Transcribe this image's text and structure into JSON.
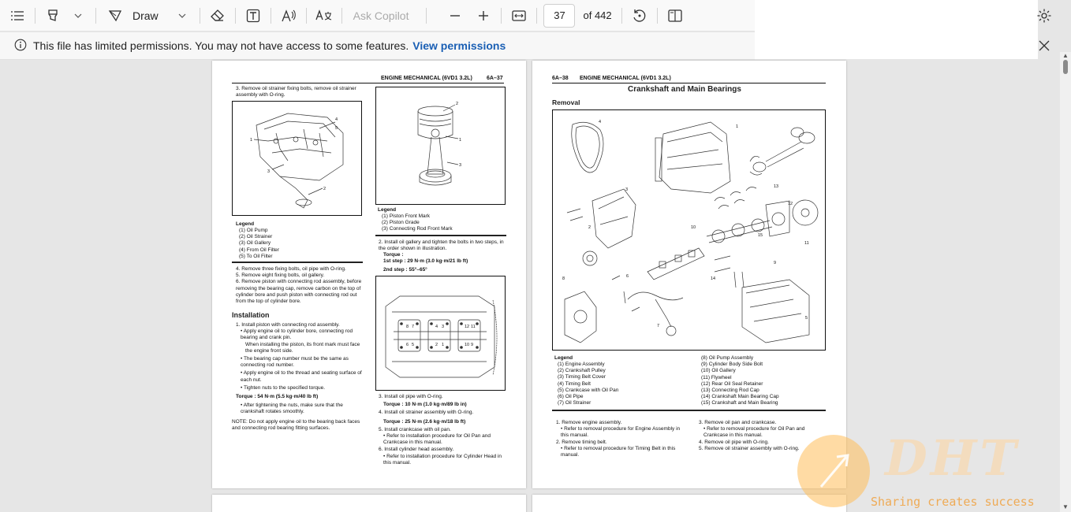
{
  "toolbar": {
    "draw_label": "Draw",
    "ask_copilot": "Ask Copilot",
    "page_current": "37",
    "page_total": "of 442"
  },
  "infobar": {
    "message": "This file has limited permissions. You may not have access to some features.",
    "link": "View permissions"
  },
  "page_left": {
    "header": "ENGINE MECHANICAL (6VD1 3.2L)",
    "page_no": "6A–37",
    "step3": "3. Remove oil strainer fixing bolts, remove oil strainer assembly with O-ring.",
    "legend_title": "Legend",
    "legend1": [
      "(1)  Oil Pump",
      "(2)  Oil Strainer",
      "(3)  Oil Gallery",
      "(4)  From Oil Filter",
      "(5)  To Oil Filter"
    ],
    "steps_4_6": [
      "4. Remove three fixing bolts, oil pipe with O-ring.",
      "5. Remove eight fixing bolts, oil gallery.",
      "6. Remove piston with connecting rod assembly, before removing the bearing cap, remove carbon on the top of cylinder bore and push piston with connecting rod out from the top of cylinder bore."
    ],
    "installation_title": "Installation",
    "inst_step1": "1. Install piston with connecting rod assembly.",
    "inst_bullets": [
      "• Apply engine oil to cylinder bore, connecting rod bearing and crank pin.",
      "When installing the piston, its front mark must face the engine front side.",
      "• The bearing cap number must be the same as connecting rod number.",
      "• Apply engine oil to the thread and seating surface of each nut.",
      "• Tighten nuts to the specified torque."
    ],
    "torque1": "Torque : 54 N·m (5.5 kg·m/40 lb ft)",
    "after_tightening": "• After tightening the nuts, make sure that the crankshaft rotates smoothly.",
    "note": "NOTE: Do not apply engine oil to the bearing back faces and connecting rod bearing fitting surfaces.",
    "legend2": [
      "(1)  Piston Front Mark",
      "(2)  Piston Grade",
      "(3)  Connecting Rod Front Mark"
    ],
    "step2": "2. Install oil gallery and tighten the bolts in two steps, in the order shown in illustration.",
    "torque_label": "Torque :",
    "step_1st": "1st step : 29 N·m (3.0 kg·m/21 lb ft)",
    "step_2nd": "2nd step : 55°–65°",
    "steps_col2": [
      "3. Install oil pipe with O-ring.",
      "Torque : 10 N·m (1.0 kg·m/89 lb in)",
      "4. Install oil strainer assembly with O-ring.",
      "Torque : 25 N·m (2.6 kg·m/18 lb ft)",
      "5. Install crankcase with oil pan.",
      "• Refer to installation procedure for Oil Pan and Crankcase in this manual.",
      "6. Install cylinder head assembly.",
      "• Refer to installation procedure for Cylinder Head in this manual."
    ]
  },
  "page_right": {
    "header": "ENGINE MECHANICAL (6VD1 3.2L)",
    "page_no": "6A–38",
    "title": "Crankshaft and Main Bearings",
    "removal": "Removal",
    "legend_title": "Legend",
    "legend_a": [
      "(1)  Engine Assembly",
      "(2)  Crankshaft Pulley",
      "(3)  Timing Belt Cover",
      "(4)  Timing Belt",
      "(5)  Crankcase with Oil Pan",
      "(6)  Oil Pipe",
      "(7)  Oil Strainer"
    ],
    "legend_b": [
      "(8)  Oil Pump Assembly",
      "(9)  Cylinder Body Side Bolt",
      "(10)  Oil Gallery",
      "(11)  Flywheel",
      "(12)  Rear Oil Seal Retainer",
      "(13)  Connecting Rod Cap",
      "(14)  Crankshaft Main Bearing Cap",
      "(15)  Crankshaft and Main Bearing"
    ],
    "steps_a": [
      "1. Remove engine assembly.",
      "• Refer to removal procedure for Engine Assembly in this manual.",
      "2. Remove timing belt.",
      "• Refer to removal procedure for Timing Belt in this manual."
    ],
    "steps_b": [
      "3. Remove oil pan and crankcase.",
      "• Refer to removal procedure for Oil Pan and Crankcase in this manual.",
      "4. Remove oil pipe with O-ring.",
      "5. Remove oil strainer assembly with O-ring."
    ]
  },
  "watermark": {
    "logo": "DHT",
    "tagline": "Sharing creates success"
  }
}
